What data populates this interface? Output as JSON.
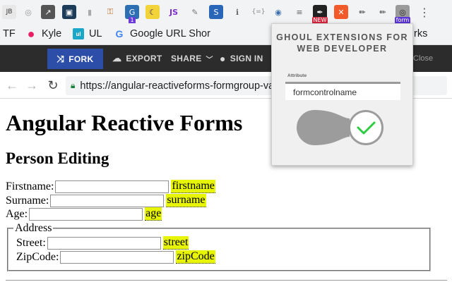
{
  "extensions_bar": {
    "icons": [
      {
        "name": "jb-extension-icon",
        "glyph": "JB",
        "bg": "#e8e8e8",
        "color": "#333"
      },
      {
        "name": "circle-extension-icon",
        "glyph": "◎",
        "bg": "transparent",
        "color": "#999"
      },
      {
        "name": "arrow-extension-icon",
        "glyph": "↗",
        "bg": "#555",
        "color": "#fff"
      },
      {
        "name": "camera-extension-icon",
        "glyph": "▣",
        "bg": "#1d3c5a",
        "color": "#fff"
      },
      {
        "name": "bottle-extension-icon",
        "glyph": "▮",
        "bg": "transparent",
        "color": "#aaa"
      },
      {
        "name": "key-extension-icon",
        "glyph": "⚿",
        "bg": "transparent",
        "color": "#b86d2a"
      },
      {
        "name": "g-extension-icon",
        "glyph": "G",
        "bg": "#2c6fb3",
        "color": "#fff",
        "badge": "1",
        "badge_color": "#6a3bd6"
      },
      {
        "name": "moon-extension-icon",
        "glyph": "☾",
        "bg": "#f3d33a",
        "color": "#2d1e6b"
      },
      {
        "name": "js-extension-icon",
        "glyph": "JS",
        "bg": "transparent",
        "color": "#7a2ed1"
      },
      {
        "name": "wand-extension-icon",
        "glyph": "✎",
        "bg": "transparent",
        "color": "#777"
      },
      {
        "name": "s-extension-icon",
        "glyph": "S",
        "bg": "#2a66b8",
        "color": "#fff"
      },
      {
        "name": "info-extension-icon",
        "glyph": "ℹ",
        "bg": "transparent",
        "color": "#666"
      },
      {
        "name": "brackets-extension-icon",
        "glyph": "{=}",
        "bg": "transparent",
        "color": "#888"
      },
      {
        "name": "globe-extension-icon",
        "glyph": "◉",
        "bg": "transparent",
        "color": "#3d6fb0"
      },
      {
        "name": "lines-extension-icon",
        "glyph": "≡",
        "bg": "transparent",
        "color": "#666"
      },
      {
        "name": "edit-new-extension-icon",
        "glyph": "✒",
        "bg": "#222",
        "color": "#fff",
        "badge": "NEW",
        "badge_color": "#d7263d"
      },
      {
        "name": "x-extension-icon",
        "glyph": "✕",
        "bg": "#f25a2a",
        "color": "#fff"
      },
      {
        "name": "pen-extension-icon",
        "glyph": "✏",
        "bg": "transparent",
        "color": "#222"
      },
      {
        "name": "pen-2-extension-icon",
        "glyph": "✏",
        "bg": "transparent",
        "color": "#222"
      },
      {
        "name": "ghoul-form-extension-icon",
        "glyph": "◎",
        "bg": "#9a9a9a",
        "color": "#222",
        "badge": "form",
        "badge_color": "#5b35d6"
      },
      {
        "name": "chrome-menu-icon",
        "glyph": "⋮",
        "bg": "transparent",
        "color": "#555"
      }
    ]
  },
  "bookmarks": [
    {
      "label": "TF",
      "icon": "",
      "icon_color": ""
    },
    {
      "label": "Kyle",
      "icon": "●",
      "icon_color": "#e91e63"
    },
    {
      "label": "UL",
      "icon": "ul",
      "icon_color": "#1aa7c9"
    },
    {
      "label": "Google URL Shor",
      "icon": "G",
      "icon_color": "#4285f4"
    },
    {
      "label": "rks",
      "icon": "",
      "icon_color": ""
    }
  ],
  "app_bar": {
    "fork": "FORK",
    "export": "EXPORT",
    "share": "SHARE",
    "sign_in": "SIGN IN",
    "close": "Close",
    "accent": "#2c4ea8"
  },
  "address_bar": {
    "url": "https://angular-reactiveforms-formgroup-vali"
  },
  "page": {
    "title": "Angular Reactive Forms",
    "subtitle": "Person Editing",
    "fields": [
      {
        "label": "Firstname:",
        "tag": "firstname"
      },
      {
        "label": "Surname:",
        "tag": "surname"
      },
      {
        "label": "Age:",
        "tag": "age"
      }
    ],
    "address": {
      "legend": "Address",
      "fields": [
        {
          "label": "Street:",
          "tag": "street"
        },
        {
          "label": "ZipCode:",
          "tag": "zipCode"
        }
      ]
    },
    "highlight_color": "#e8f500"
  },
  "popup": {
    "title_line1": "GHOUL EXTENSIONS FOR",
    "title_line2": "WEB DEVELOPER",
    "attribute_label": "Attribute",
    "attribute_value": "formcontrolname",
    "toggle_on": true,
    "check_color": "#2ecc40"
  }
}
